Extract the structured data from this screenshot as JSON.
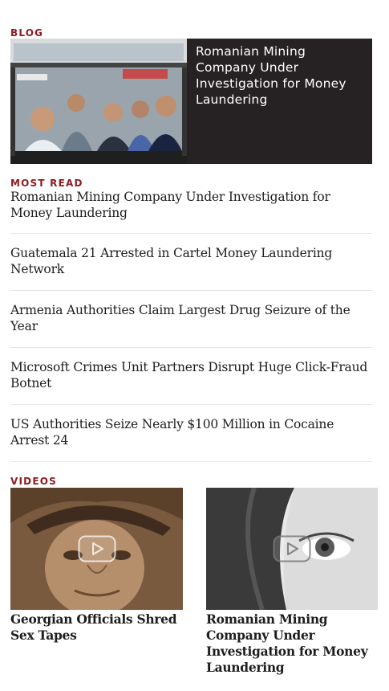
{
  "blog": {
    "label": "BLOG",
    "feature_title": "Romanian Mining Company Under Investigation for Money Laundering"
  },
  "most_read": {
    "label": "MOST READ",
    "items": [
      "Romanian Mining Company Under Investigation for Money Laundering",
      "Guatemala 21 Arrested in Cartel Money Laundering Network",
      "Armenia Authorities Claim Largest Drug Seizure of the Year",
      "Microsoft Crimes Unit Partners Disrupt Huge Click-Fraud Botnet",
      "US Authorities Seize Nearly $100 Million in Cocaine Arrest 24"
    ]
  },
  "videos": {
    "label": "VIDEOS",
    "items": [
      {
        "title": "Georgian Officials Shred Sex Tapes",
        "thumb_icon": "play-icon"
      },
      {
        "title": "Romanian Mining Company Under Investigation for Money Laundering",
        "thumb_icon": "play-icon"
      }
    ]
  },
  "colors": {
    "section_label": "#8e1b22",
    "blog_panel": "#262223",
    "text": "#1d1d1d",
    "divider": "#e6e6e6"
  }
}
